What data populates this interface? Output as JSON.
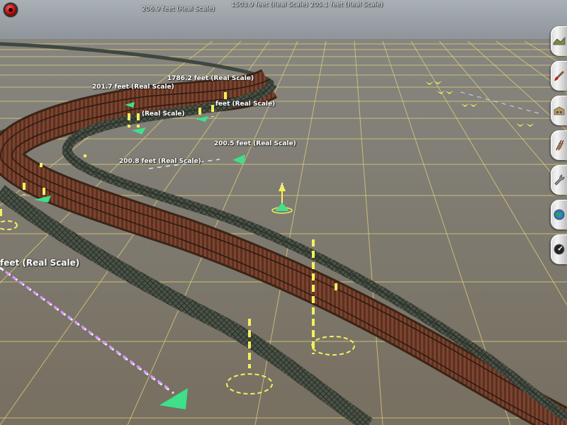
{
  "window": {
    "close_button": "close-circle-icon"
  },
  "distance_labels": {
    "top_center_left": "206.9 feet  (Real Scale)",
    "top_center_right": "1503.9 feet  (Real Scale) 205.1 feet (Real Scale)",
    "curve_upper": "1786.2 feet  (Real Scale)",
    "curve_left": "201.7 feet  (Real Scale)",
    "curve_mid_partial": "(Real Scale)",
    "curve_mid_small": "feet (Real Scale)",
    "middle_right": "200.5 feet  (Real Scale)",
    "middle_left": "200.8 feet  (Real Scale)",
    "left_edge_large": "feet  (Real Scale)"
  },
  "toolbar": {
    "tools": [
      {
        "name": "terrain-tool",
        "icon": "terrain-brush-icon"
      },
      {
        "name": "paint-tool",
        "icon": "paint-brush-icon"
      },
      {
        "name": "objects-tool",
        "icon": "building-icon"
      },
      {
        "name": "track-tool",
        "icon": "track-icon"
      },
      {
        "name": "trackside-tool",
        "icon": "wrench-icon"
      },
      {
        "name": "topology-tool",
        "icon": "globe-icon"
      },
      {
        "name": "settings-tool",
        "icon": "gauge-icon"
      }
    ]
  },
  "colors": {
    "sky": "#9aa3ab",
    "ground": "#7f7a70",
    "grid": "#e6d67a",
    "track_bed": "#6b3a28",
    "bridge_girder": "#4c5448",
    "marker": "#f6f25a",
    "spline_point": "#44e08a"
  }
}
